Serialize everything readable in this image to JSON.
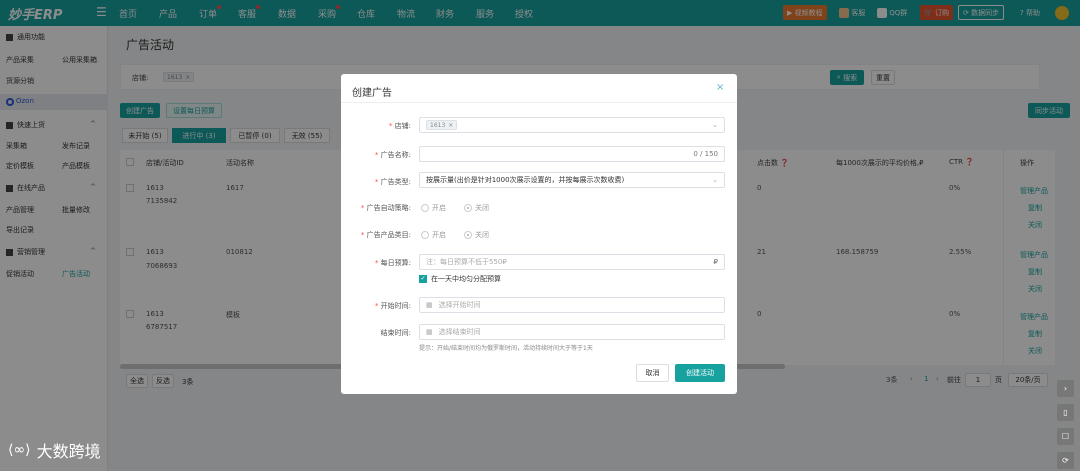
{
  "topnav": {
    "logo": "妙手ERP",
    "items": [
      {
        "label": "首页",
        "dot": false
      },
      {
        "label": "产品",
        "dot": false
      },
      {
        "label": "订单",
        "dot": true
      },
      {
        "label": "客服",
        "dot": true
      },
      {
        "label": "数据",
        "dot": false
      },
      {
        "label": "采购",
        "dot": true
      },
      {
        "label": "仓库",
        "dot": false
      },
      {
        "label": "物流",
        "dot": false
      },
      {
        "label": "财务",
        "dot": false
      },
      {
        "label": "服务",
        "dot": false
      },
      {
        "label": "授权",
        "dot": false
      }
    ],
    "right": {
      "video": "视频教程",
      "service": "客服",
      "qq": "QQ群",
      "subscribe": "订购",
      "sync": "数据同步",
      "help": "帮助"
    }
  },
  "sidebar": {
    "common": "通用功能",
    "row1": [
      "产品采集",
      "公用采集箱"
    ],
    "row2": "货源分销",
    "platform": "Ozon",
    "sections": [
      {
        "title": "快速上货",
        "rows": [
          [
            "采集箱",
            "发布记录"
          ],
          [
            "定价模板",
            "产品模板"
          ]
        ]
      },
      {
        "title": "在线产品",
        "rows": [
          [
            "产品管理",
            "批量修改"
          ],
          [
            "导出记录"
          ]
        ]
      },
      {
        "title": "营销管理",
        "rows": [
          [
            "促销活动",
            "广告活动"
          ]
        ]
      }
    ]
  },
  "page": {
    "title": "广告活动",
    "filter": {
      "store_label": "店铺:",
      "store_tag": "1613",
      "search": "搜索",
      "reset": "重置"
    },
    "actions": {
      "create": "创建广告",
      "daily": "设置每日预算",
      "sync": "同步活动"
    },
    "tabs": [
      "未开始 (5)",
      "进行中 (3)",
      "已暂停 (0)",
      "无效 (55)"
    ],
    "headers": {
      "store": "店铺/活动ID",
      "name": "活动名称",
      "clicks": "点击数",
      "avg": "每1000次展示的平均价格,₽",
      "ctr": "CTR",
      "op": "操作"
    },
    "rows": [
      {
        "store": "1613",
        "id": "7135842",
        "name": "1617",
        "clicks": "0",
        "avg": "",
        "ctr": "0%"
      },
      {
        "store": "1613",
        "id": "7068693",
        "name": "010812",
        "clicks": "21",
        "avg": "168.158759",
        "ctr": "2.55%"
      },
      {
        "store": "1613",
        "id": "6787517",
        "name": "模板",
        "clicks": "0",
        "avg": "",
        "ctr": "0%"
      }
    ],
    "row_ops": [
      "管理产品",
      "复制",
      "关闭"
    ],
    "footer": {
      "select_all": "全选",
      "invert": "反选",
      "count": "3条",
      "total": "3条",
      "page": "1",
      "goto": "前往",
      "goto_page": "1",
      "page_unit": "页",
      "page_size": "20条/页"
    }
  },
  "modal": {
    "title": "创建广告",
    "close": "×",
    "store": {
      "label": "店铺:",
      "tag": "1613"
    },
    "name": {
      "label": "广告名称:",
      "counter": "0 / 150"
    },
    "type": {
      "label": "广告类型:",
      "value": "按展示量(出价是针对1000次展示设置的，并按每展示次数收费)"
    },
    "auto": {
      "label": "广告自动策略:",
      "on": "开启",
      "off": "关闭"
    },
    "cat": {
      "label": "广告产品类目:",
      "on": "开启",
      "off": "关闭"
    },
    "budget": {
      "label": "每日预算:",
      "placeholder": "注：每日预算不低于550₽",
      "unit": "₽",
      "check": "在一天中均匀分配预算"
    },
    "start": {
      "label": "开始时间:",
      "placeholder": "选择开始时间"
    },
    "end": {
      "label": "结束时间:",
      "placeholder": "选择结束时间",
      "hint": "提示：开始/结束时间均为俄罗斯时间，活动持续时间大于等于1天"
    },
    "cancel": "取消",
    "submit": "创建活动"
  },
  "watermark": "大数跨境"
}
